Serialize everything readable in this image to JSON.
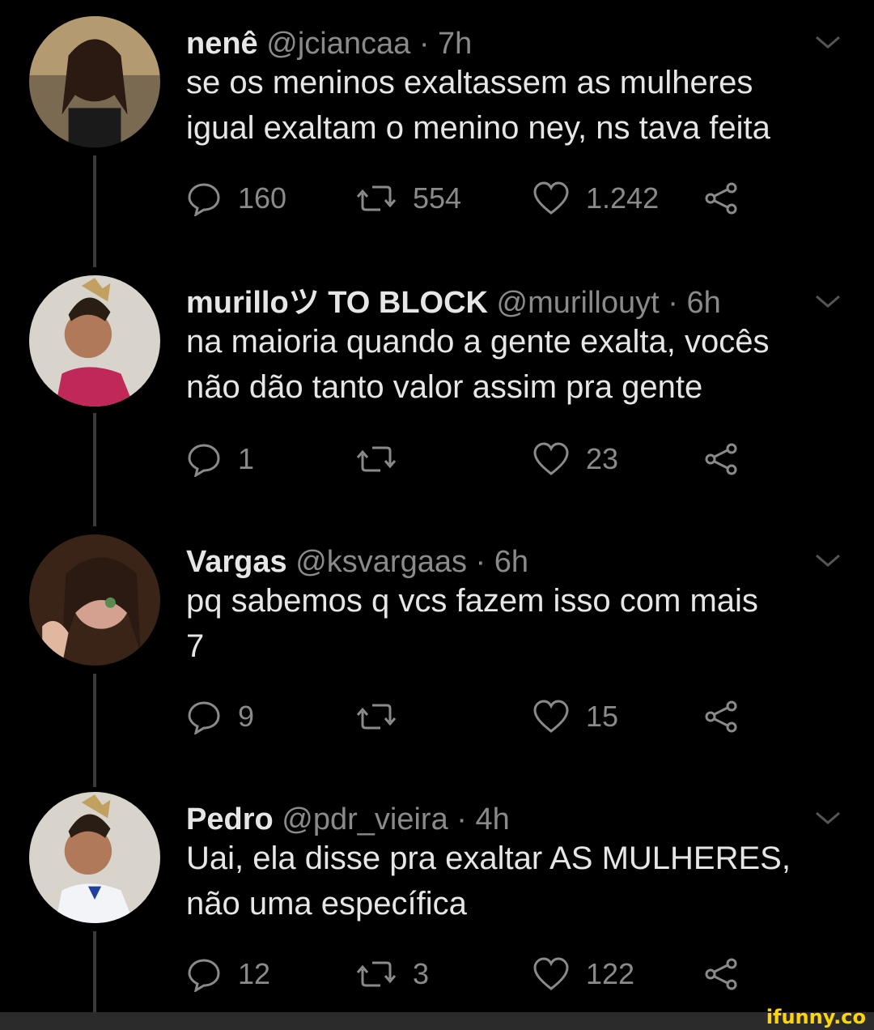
{
  "tweets": [
    {
      "name": "nenê",
      "handle": "@jciancaa",
      "sep": "·",
      "time": "7h",
      "lines": [
        "se os meninos exaltassem as mulheres",
        "igual exaltam o menino ney, ns tava feita"
      ],
      "replies": "160",
      "retweets": "554",
      "likes": "1.242"
    },
    {
      "name": "murilloツ TO BLOCK",
      "handle": "@murillouyt",
      "sep": "·",
      "time": "6h",
      "lines": [
        "na maioria quando a gente exalta, vocês",
        "não dão tanto valor assim pra gente"
      ],
      "replies": "1",
      "retweets": "",
      "likes": "23"
    },
    {
      "name": "Vargas",
      "handle": "@ksvargaas",
      "sep": "·",
      "time": "6h",
      "lines": [
        "pq sabemos q vcs fazem isso com mais",
        "7"
      ],
      "replies": "9",
      "retweets": "",
      "likes": "15"
    },
    {
      "name": "Pedro",
      "handle": "@pdr_vieira",
      "sep": "·",
      "time": "4h",
      "lines": [
        "Uai, ela disse pra exaltar AS MULHERES,",
        "não uma específica"
      ],
      "replies": "12",
      "retweets": "3",
      "likes": "122"
    }
  ],
  "watermark": "ifunny.co",
  "icons": [
    "reply-icon",
    "retweet-icon",
    "like-icon",
    "share-icon",
    "chevron-down-icon"
  ],
  "colors": {
    "background": "#000000",
    "text": "#e6e6e6",
    "muted": "#8a8a8a",
    "watermark": "#ffd600"
  }
}
